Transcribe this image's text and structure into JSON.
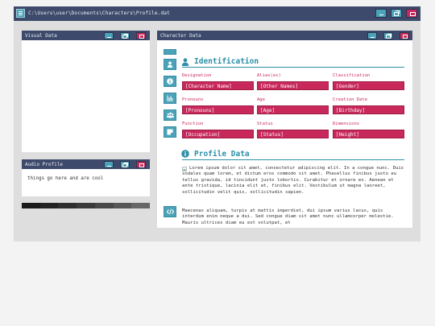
{
  "window": {
    "title": "C:\\Users\\user\\Documents\\Characters\\Profile.dat"
  },
  "panels": {
    "visual": {
      "title": "Visual Data"
    },
    "audio": {
      "title": "Audio Profile",
      "text": "things go here and are cool"
    },
    "character": {
      "title": "Character Data"
    }
  },
  "swatches": [
    "#1a1a1a",
    "#232323",
    "#2e2e2e",
    "#3a3a3a",
    "#484848",
    "#575757",
    "#676767"
  ],
  "identification": {
    "title": "Identification",
    "fields": [
      {
        "label": "Designation",
        "value": "[Character Name]"
      },
      {
        "label": "Alias(es)",
        "value": "[Other Names]"
      },
      {
        "label": "Classification",
        "value": "[Gender]"
      },
      {
        "label": "Pronouns",
        "value": "[Pronouns]"
      },
      {
        "label": "Age",
        "value": "[Age]"
      },
      {
        "label": "Creation Date",
        "value": "[Birthday]"
      },
      {
        "label": "Function",
        "value": "[Occupation]"
      },
      {
        "label": "Status",
        "value": "[Status]"
      },
      {
        "label": "Dimensions",
        "value": "[Height]"
      }
    ]
  },
  "profile": {
    "title": "Profile Data",
    "paragraph1": "Lorem ipsum dolor sit amet, consectetur adipiscing elit. In a congue nunc. Duis sodales quam lorem, et dictum eros commodo sit amet. Phasellus finibus justo eu tellus gravida, id tincidunt justo lobortis. Curabitur et ornare ex. Aenean et ante tristique, lacinia elit at, finibus elit. Vestibulum ut magna laoreet, sollicitudin velit quis, sollicitudin sapien.",
    "paragraph2": "Maecenas aliquam, turpis at mattis imperdiet, dui ipsum varius lacus, quis interdum enim neque a dui. Sed congue diam sit amet nunc ullamcorper molestie. Mauris ultrices diam eu est volutpat, et"
  },
  "colors": {
    "titlebar": "#3d4a6b",
    "accent": "#4aa3b8",
    "close": "#c8285a",
    "heading": "#2e8fa8"
  }
}
